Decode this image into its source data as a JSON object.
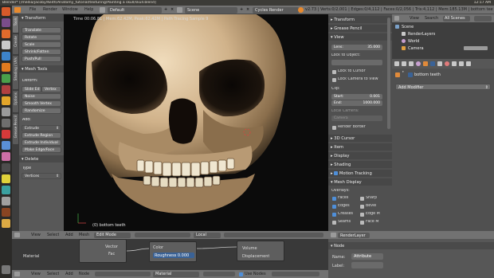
{
  "os": {
    "window_title": "Blender* [/media/jacoby/Keith/Anatomy_tutorial/texturing/Painting a skull/skull.blend]",
    "tray": "12:17 AM"
  },
  "header": {
    "menus": [
      "File",
      "Render",
      "Window",
      "Help"
    ],
    "layout": "Default",
    "scene": "Scene",
    "engine": "Cycles Render",
    "stats": "v2.73 | Verts:0/2,001 | Edges:0/4,112 | Faces:0/2,056 | Tris:4,112 | Mem:185.13M | bottom teeth"
  },
  "tool_tabs": [
    "Tools",
    "Create",
    "Shading / UVs",
    "Options",
    "Grease Pencil"
  ],
  "tool_shelf": {
    "transform_title": "Transform",
    "transform_buttons": [
      "Translate",
      "Rotate",
      "Scale",
      "Shrink/Fatten",
      "Push/Pull"
    ],
    "mesh_tools_title": "Mesh Tools",
    "deform_label": "Deform:",
    "slide_buttons": [
      "Slide Ed",
      "Vertex"
    ],
    "deform_buttons": [
      "Noise",
      "Smooth Vertex",
      "Randomize"
    ],
    "add_label": "Add:",
    "extrude_select": "Extrude",
    "add_buttons": [
      "Extrude Region",
      "Extrude Individual",
      "Make Edge/Face"
    ],
    "delete_title": "Delete",
    "type_label": "Type",
    "type_value": "Vertices"
  },
  "viewport": {
    "status": "Time 00:06.81 | Mem:62.42M, Peak:62.42M | Path Tracing Sample 9",
    "object_label": "(0) bottom teeth"
  },
  "npanel": {
    "transform": "Transform",
    "grease_pencil": "Grease Pencil",
    "view": "View",
    "lens_label": "Lens:",
    "lens_value": "35.000",
    "lock_object": "Lock to Object:",
    "lock_cursor": "Lock to Cursor",
    "lock_camera": "Lock Camera to View",
    "clip_label": "Clip:",
    "clip_start_label": "Start:",
    "clip_start": "0.001",
    "clip_end_label": "End:",
    "clip_end": "1000.000",
    "local_camera": "Local Camera:",
    "camera": "Camera",
    "render_border": "Render Border",
    "cursor_3d": "3D Cursor",
    "item": "Item",
    "display": "Display",
    "shading": "Shading",
    "motion_tracking": "Motion Tracking",
    "mesh_display": "Mesh Display",
    "overlays": "Overlays:",
    "overlay_left": [
      "Faces",
      "Edges",
      "Creases",
      "Seams"
    ],
    "overlay_right": [
      "Sharp",
      "Bevel",
      "Edge M",
      "Face M"
    ]
  },
  "outliner": {
    "view": "View",
    "search": "Search",
    "scope": "All Scenes",
    "items": [
      "Scene",
      "RenderLayers",
      "World",
      "Camera"
    ]
  },
  "properties": {
    "object_name": "bottom teeth",
    "add_modifier": "Add Modifier"
  },
  "node_header": {
    "menus": [
      "View",
      "Select",
      "Add",
      "Mesh"
    ],
    "mode": "Edit Mode",
    "orientation": "Local"
  },
  "nodes": {
    "material_label": "Material",
    "sockets_left": [
      "Vector",
      "Fac"
    ],
    "color_label": "Color",
    "roughness_label": "Roughness",
    "roughness_value": "0.000",
    "output_sockets": [
      "Volume",
      "Displacement"
    ]
  },
  "node_footer": {
    "menus": [
      "View",
      "Select",
      "Add",
      "Node"
    ],
    "material": "Material",
    "use_nodes": "Use Nodes"
  },
  "right_bottom": {
    "render_layer": "RenderLayer",
    "node_title": "Node",
    "name_label": "Name:",
    "name_value": "Attribute",
    "label_label": "Label:"
  },
  "colors": {
    "accent_blue": "#3a6296",
    "header_gray": "#727272",
    "panel_gray": "#585858",
    "bone": "#d8c4a4"
  }
}
